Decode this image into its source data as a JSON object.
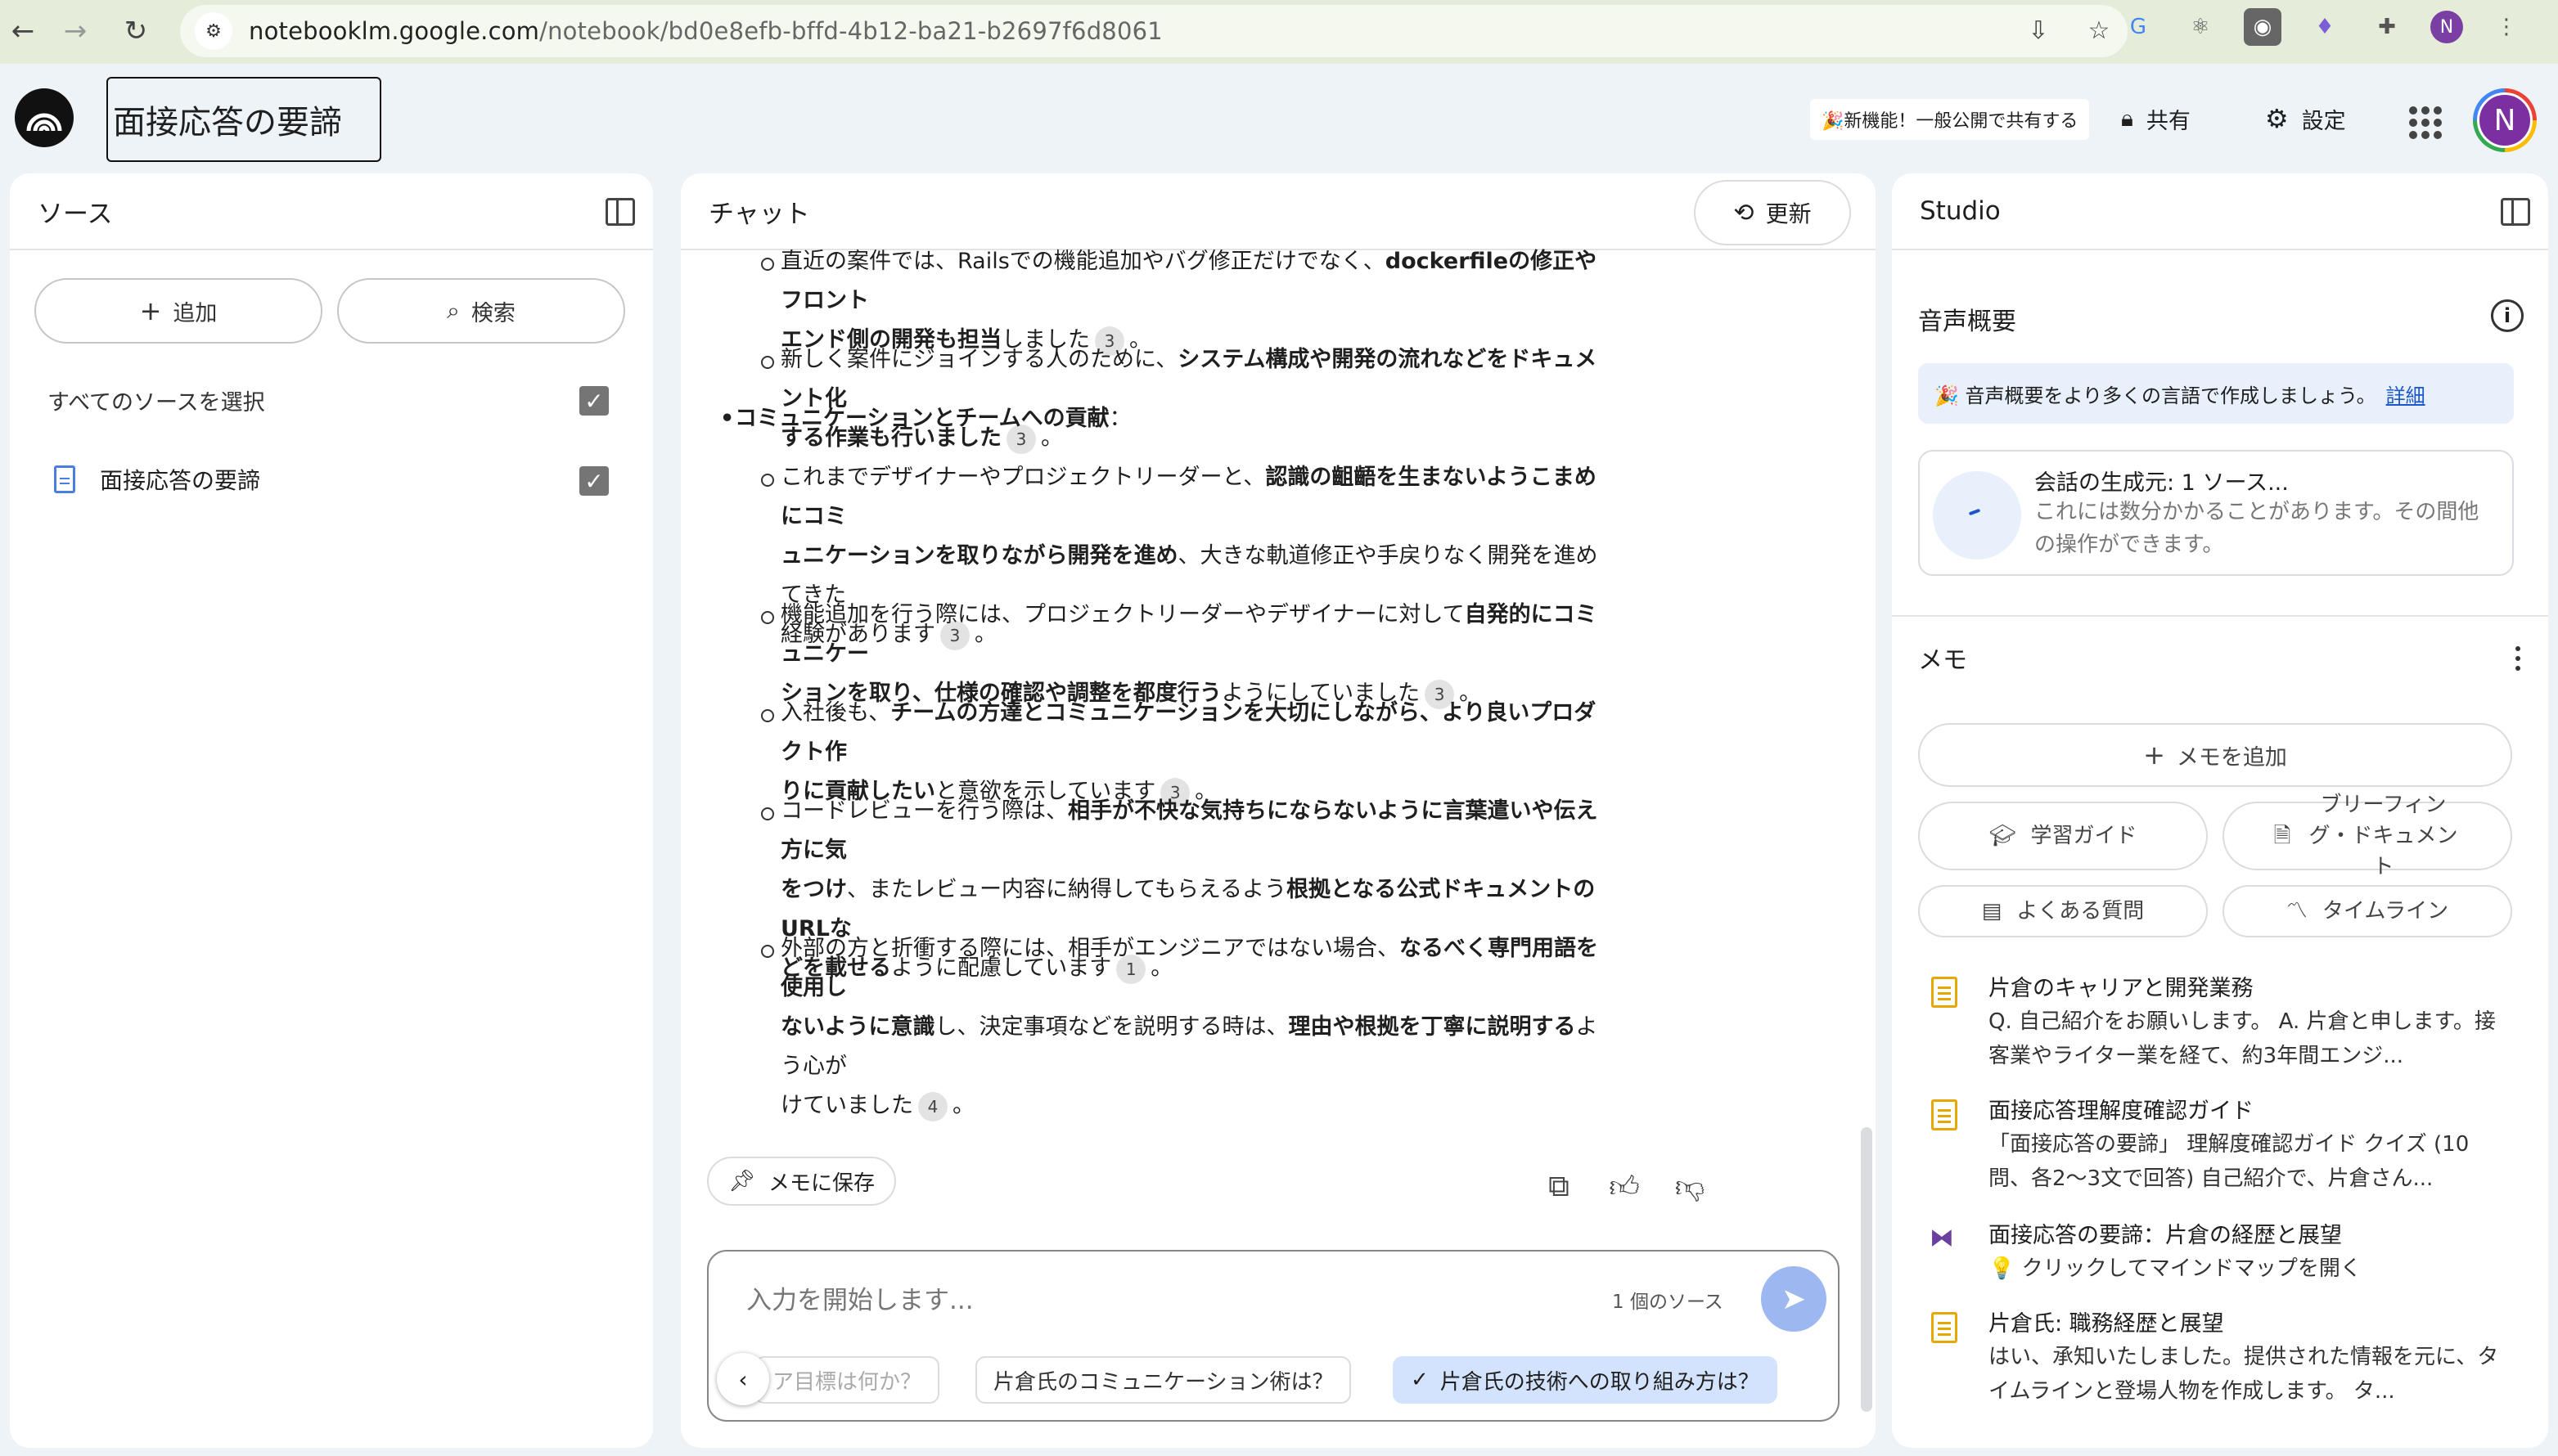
{
  "browser": {
    "url_host": "notebooklm.google.com",
    "url_path": "/notebook/bd0e8efb-bffd-4b12-ba21-b2697f6d8061",
    "profile_initial": "N"
  },
  "header": {
    "notebook_title": "面接応答の要諦",
    "promo": "🎉新機能！一般公開で共有する",
    "share_label": "共有",
    "settings_label": "設定",
    "avatar_initial": "N"
  },
  "sources": {
    "title": "ソース",
    "add_label": "追加",
    "search_label": "検索",
    "select_all_label": "すべてのソースを選択",
    "items": [
      {
        "label": "面接応答の要諦",
        "checked": true
      }
    ]
  },
  "chat": {
    "title": "チャット",
    "refresh_label": "更新",
    "messages": {
      "p1a": "直近の案件では、Railsでの機能追加やバグ修正だけでなく、",
      "p1b": "dockerfileの修正やフロント",
      "p1c": "エンド側の開発も担当",
      "p1d": "しました",
      "p1cite": "3",
      "p1end": "。",
      "p2a": "新しく案件にジョインする人のために、",
      "p2b": "システム構成や開発の流れなどをドキュメント化",
      "p2c": "する作業も行いました",
      "p2cite": "3",
      "p2end": "。",
      "bullet": "コミュニケーションとチームへの貢献",
      "bullet_end": "：",
      "p3a": "これまでデザイナーやプロジェクトリーダーと、",
      "p3b": "認識の齟齬を生まないようこまめにコミ",
      "p3c": "ュニケーションを取りながら開発を進め",
      "p3d": "、大きな軌道修正や手戻りなく開発を進めてきた",
      "p3e": "経験があります",
      "p3cite": "3",
      "p3end": "。",
      "p4a": "機能追加を行う際には、プロジェクトリーダーやデザイナーに対して",
      "p4b": "自発的にコミュニケー",
      "p4c": "ションを取り、仕様の確認や調整を都度行う",
      "p4d": "ようにしていました",
      "p4cite": "3",
      "p4end": "。",
      "p5a": "入社後も、",
      "p5b": "チームの方達とコミュニケーションを大切にしながら、より良いプロダクト作",
      "p5c": "りに貢献したい",
      "p5d": "と意欲を示しています",
      "p5cite": "3",
      "p5end": "。",
      "p6a": "コードレビューを行う際は、",
      "p6b": "相手が不快な気持ちにならないように言葉遣いや伝え方に気",
      "p6c": "をつけ",
      "p6d": "、またレビュー内容に納得してもらえるよう",
      "p6e": "根拠となる公式ドキュメントのURLな",
      "p6f": "どを載せる",
      "p6g": "ように配慮しています",
      "p6cite": "1",
      "p6end": "。",
      "p7a": "外部の方と折衝する際には、相手がエンジニアではない場合、",
      "p7b": "なるべく専門用語を使用し",
      "p7c": "ないように意識",
      "p7d": "し、決定事項などを説明する時は、",
      "p7e": "理由や根拠を丁寧に説明する",
      "p7f": "よう心が",
      "p7g": "けていました",
      "p7cite": "4",
      "p7end": "。"
    },
    "save_memo_label": "メモに保存",
    "input_placeholder": "入力を開始します...",
    "source_count": "1 個のソース",
    "suggestions": [
      "ア目標は何か？",
      "片倉氏のコミュニケーション術は？",
      "片倉氏の技術への取り組み方は？"
    ]
  },
  "studio": {
    "title": "Studio",
    "audio_title": "音声概要",
    "notice_text": "🎉 音声概要をより多くの言語で作成しましょう。",
    "notice_link": "詳細",
    "gen_title": "会話の生成元: 1 ソース...",
    "gen_sub": "これには数分かかることがあります。その間他の操作ができます。",
    "memo_title": "メモ",
    "add_memo_label": "メモを追加",
    "tools": [
      "学習ガイド",
      "ブリーフィング・ドキュメント",
      "よくある質問",
      "タイムライン"
    ],
    "notes": [
      {
        "title": "片倉のキャリアと開発業務",
        "body": "Q. 自己紹介をお願いします。 A. 片倉と申します。接客業やライター業を経て、約3年間エンジ...",
        "icon": "note-icon"
      },
      {
        "title": "面接応答理解度確認ガイド",
        "body": "「面接応答の要諦」 理解度確認ガイド クイズ (10問、各2〜3文で回答) 自己紹介で、片倉さん...",
        "icon": "note-icon"
      },
      {
        "title": "面接応答の要諦：片倉の経歴と展望",
        "body": "💡 クリックしてマインドマップを開く",
        "icon": "mindmap-icon"
      },
      {
        "title": "片倉氏: 職務経歴と展望",
        "body": "はい、承知いたしました。提供された情報を元に、タイムラインと登場人物を作成します。 タ...",
        "icon": "note-icon"
      }
    ]
  },
  "colors": {
    "accent": "#1a57c9",
    "send": "#9db8f0",
    "chip_active": "#d3e3fd",
    "note_icon": "#e6a700"
  }
}
